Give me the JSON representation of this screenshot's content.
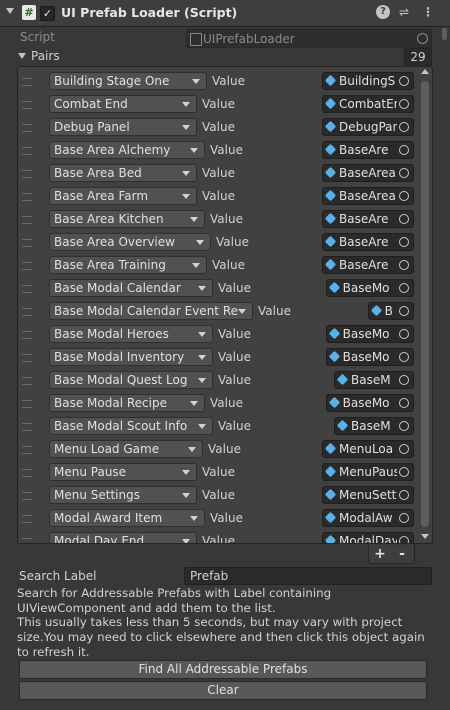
{
  "component": {
    "title": "UI Prefab Loader (Script)",
    "enabled_mark": "✓",
    "script_icon_glyph": "#",
    "help_icon": "help-icon",
    "preset_icon": "preset-icon",
    "menu_icon": "menu-icon"
  },
  "script": {
    "label": "Script",
    "value": "UIPrefabLoader"
  },
  "pairs": {
    "label": "Pairs",
    "count": "29"
  },
  "items": [
    {
      "key": "Building Stage One",
      "value_label": "Value",
      "prefab": "BuildingS"
    },
    {
      "key": "Combat End",
      "value_label": "Value",
      "prefab": "CombatEn"
    },
    {
      "key": "Debug Panel",
      "value_label": "Value",
      "prefab": "DebugPan"
    },
    {
      "key": "Base Area Alchemy",
      "value_label": "Value",
      "prefab": "BaseAre"
    },
    {
      "key": "Base Area Bed",
      "value_label": "Value",
      "prefab": "BaseAreaB"
    },
    {
      "key": "Base Area Farm",
      "value_label": "Value",
      "prefab": "BaseAreaF"
    },
    {
      "key": "Base Area Kitchen",
      "value_label": "Value",
      "prefab": "BaseAre"
    },
    {
      "key": "Base Area Overview",
      "value_label": "Value",
      "prefab": "BaseAre"
    },
    {
      "key": "Base Area Training",
      "value_label": "Value",
      "prefab": "BaseAre"
    },
    {
      "key": "Base Modal Calendar",
      "value_label": "Value",
      "prefab": "BaseMo"
    },
    {
      "key": "Base Modal Calendar Event Repo",
      "value_label": "Value",
      "prefab": "B"
    },
    {
      "key": "Base Modal Heroes",
      "value_label": "Value",
      "prefab": "BaseMo"
    },
    {
      "key": "Base Modal Inventory",
      "value_label": "Value",
      "prefab": "BaseMo"
    },
    {
      "key": "Base Modal Quest Log",
      "value_label": "Value",
      "prefab": "BaseM"
    },
    {
      "key": "Base Modal Recipe",
      "value_label": "Value",
      "prefab": "BaseMo"
    },
    {
      "key": "Base Modal Scout Info",
      "value_label": "Value",
      "prefab": "BaseM"
    },
    {
      "key": "Menu Load Game",
      "value_label": "Value",
      "prefab": "MenuLoa"
    },
    {
      "key": "Menu Pause",
      "value_label": "Value",
      "prefab": "MenuPaus"
    },
    {
      "key": "Menu Settings",
      "value_label": "Value",
      "prefab": "MenuSetti"
    },
    {
      "key": "Modal Award Item",
      "value_label": "Value",
      "prefab": "ModalAw"
    },
    {
      "key": "Modal Day End",
      "value_label": "Value",
      "prefab": "ModalDay"
    }
  ],
  "list_buttons": {
    "add": "+",
    "remove": "-"
  },
  "search": {
    "label": "Search Label",
    "value": "Prefab"
  },
  "help_text": {
    "line1": "Search for Addressable Prefabs with Label containing UIViewComponent and add them to the list.",
    "line2": "This usually takes less than 5 seconds, but may vary with project size.You may need to click elsewhere and then click this object again to refresh it."
  },
  "buttons": {
    "find_all": "Find All Addressable Prefabs",
    "clear": "Clear"
  }
}
